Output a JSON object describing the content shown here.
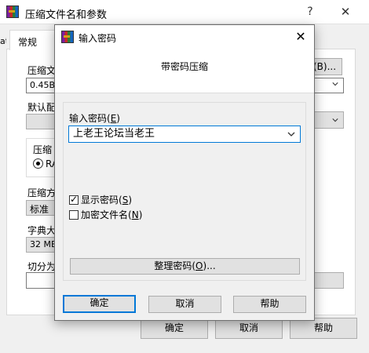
{
  "background_window": {
    "title": "压缩文件名和参数",
    "help_glyph": "?",
    "close_glyph": "✕",
    "tab_fragment": "at",
    "tab_label": "常规",
    "archive_name_label": "压缩文",
    "archive_name_value": "0.45B.",
    "browse_button": "(B)...",
    "default_profile_label": "默认配",
    "compress_format_label": "压缩",
    "radio_label": "RA",
    "method_label": "压缩方",
    "method_value": "标准",
    "dict_label": "字典大",
    "dict_value": "32 MB",
    "split_label": "切分为",
    "ok_button": "确定",
    "cancel_button": "取消",
    "help_button": "帮助"
  },
  "dialog": {
    "title": "输入密码",
    "close_glyph": "✕",
    "header": "带密码压缩",
    "password_label": "输入密码",
    "password_label_hotkey": "E",
    "password_value": "上老王论坛当老王",
    "show_password_label": "显示密码",
    "show_password_hotkey": "S",
    "show_password_checked": true,
    "encrypt_names_label": "加密文件名",
    "encrypt_names_hotkey": "N",
    "encrypt_names_checked": false,
    "organize_button": "整理密码",
    "organize_hotkey": "O",
    "organize_suffix": "...",
    "ok_button": "确定",
    "cancel_button": "取消",
    "help_button": "帮助"
  },
  "icons": {
    "app": "winrar-icon",
    "dropdown": "chevron-down-icon",
    "radio": "radio-selected-icon"
  }
}
